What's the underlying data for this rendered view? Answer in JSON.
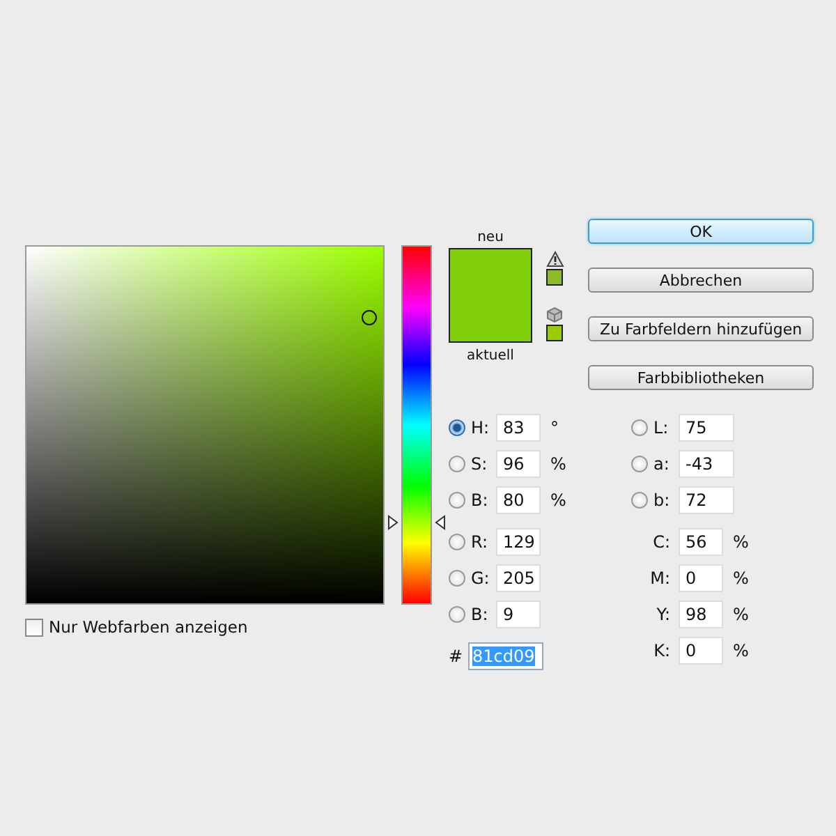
{
  "preview": {
    "new": {
      "label": "neu",
      "color": "#81cd09"
    },
    "current": {
      "label": "aktuell",
      "color": "#81cd09"
    }
  },
  "hue_slider": {
    "level": 0.23
  },
  "gamut_swatch": {
    "color": "#8bbb2a"
  },
  "websafe_swatch": {
    "color": "#99cc00"
  },
  "buttons": [
    {
      "label": "OK",
      "default": true
    },
    {
      "label": "Abbrechen",
      "default": false
    },
    {
      "label": "Zu Farbfeldern hinzufügen",
      "default": false
    },
    {
      "label": "Farbbibliotheken",
      "default": false
    }
  ],
  "hsb": [
    {
      "label": "H:",
      "value": "83",
      "unit": "°",
      "selected": true
    },
    {
      "label": "S:",
      "value": "96",
      "unit": "%",
      "selected": false
    },
    {
      "label": "B:",
      "value": "80",
      "unit": "%",
      "selected": false
    }
  ],
  "rgb": [
    {
      "label": "R:",
      "value": "129",
      "selected": false
    },
    {
      "label": "G:",
      "value": "205",
      "selected": false
    },
    {
      "label": "B:",
      "value": "9",
      "selected": false
    }
  ],
  "hex": {
    "label": "#",
    "value": "81cd09"
  },
  "lab": [
    {
      "label": "L:",
      "value": "75",
      "selected": false
    },
    {
      "label": "a:",
      "value": "-43",
      "selected": false
    },
    {
      "label": "b:",
      "value": "72",
      "selected": false
    }
  ],
  "cmyk": [
    {
      "label": "C:",
      "value": "56",
      "unit": "%"
    },
    {
      "label": "M:",
      "value": "0",
      "unit": "%"
    },
    {
      "label": "Y:",
      "value": "98",
      "unit": "%"
    },
    {
      "label": "K:",
      "value": "0",
      "unit": "%"
    }
  ],
  "web_only": {
    "label": "Nur Webfarben anzeigen",
    "checked": false
  }
}
